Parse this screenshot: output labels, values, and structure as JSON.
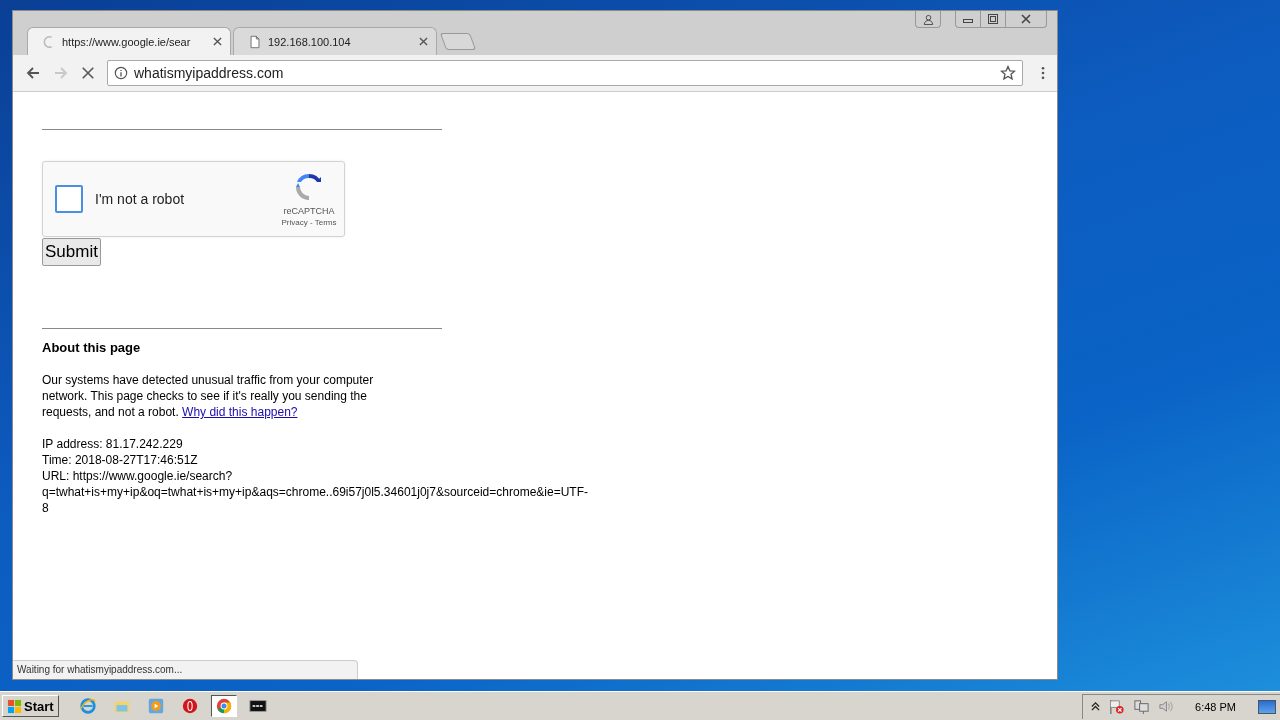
{
  "browser": {
    "tabs": [
      {
        "kind": "loading",
        "title": "https://www.google.ie/sear",
        "selected": true
      },
      {
        "kind": "document",
        "title": "192.168.100.104",
        "selected": false
      }
    ],
    "toolbar": {
      "back_disabled": false,
      "forward_disabled": true,
      "address": "whatismyipaddress.com"
    },
    "status": "Waiting for whatismyipaddress.com..."
  },
  "page": {
    "captcha": {
      "label": "I'm not a robot",
      "checked": false,
      "brand": "reCAPTCHA",
      "links": "Privacy - Terms"
    },
    "submit": "Submit",
    "heading": "About this page",
    "paragraph": "Our systems have detected unusual traffic from your computer network. This page checks to see if it's really you sending the requests, and not a robot.",
    "link": "Why did this happen?",
    "details": [
      "IP address: 81.17.242.229",
      "Time: 2018-08-27T17:46:51Z",
      "URL: https://www.google.ie/search?",
      "q=twhat+is+my+ip&oq=twhat+is+my+ip&aqs=chrome..69i57j0l5.34601j0j7&sourceid=chrome&ie=UTF-",
      "8"
    ]
  },
  "taskbar": {
    "start": "Start",
    "buttons": [
      {
        "kind": "ie",
        "selected": false
      },
      {
        "kind": "explorer",
        "selected": false
      },
      {
        "kind": "media",
        "selected": false
      },
      {
        "kind": "opera",
        "selected": false
      },
      {
        "kind": "chrome",
        "selected": true
      },
      {
        "kind": "console",
        "selected": false
      }
    ],
    "clock": "6:48 PM"
  }
}
